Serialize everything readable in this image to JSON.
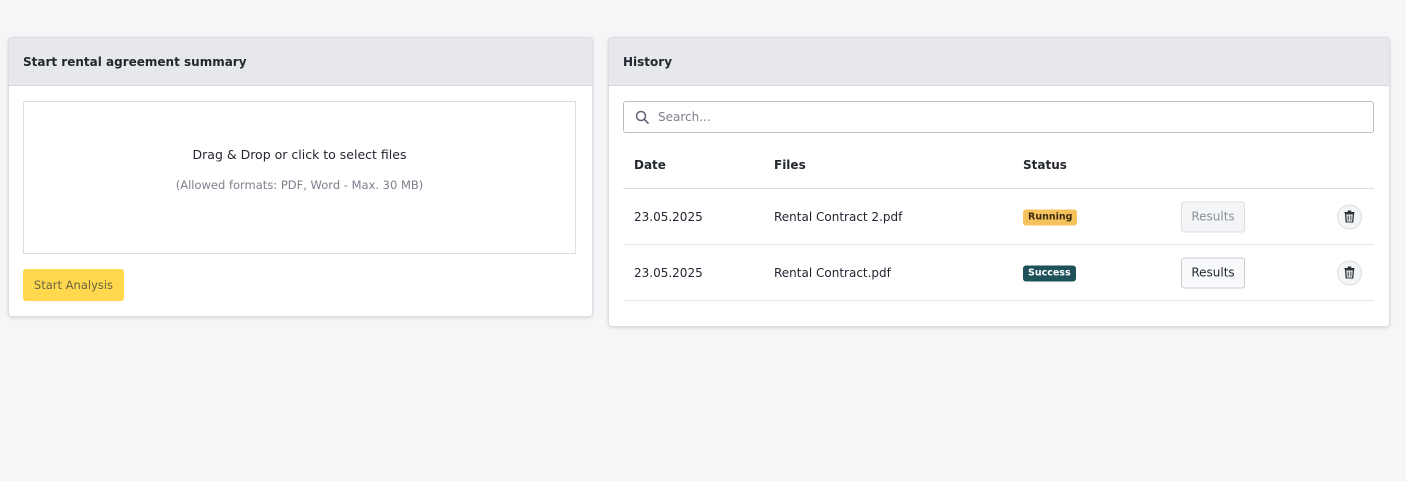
{
  "upload": {
    "title": "Start rental agreement summary",
    "dropzone_title": "Drag & Drop or click to select files",
    "dropzone_hint": "(Allowed formats: PDF, Word - Max. 30 MB)",
    "start_button": "Start Analysis"
  },
  "history": {
    "title": "History",
    "search_placeholder": "Search...",
    "columns": {
      "date": "Date",
      "files": "Files",
      "status": "Status"
    },
    "rows": [
      {
        "date": "23.05.2025",
        "file": "Rental Contract 2.pdf",
        "status": "Running",
        "results_label": "Results",
        "results_enabled": false
      },
      {
        "date": "23.05.2025",
        "file": "Rental Contract.pdf",
        "status": "Success",
        "results_label": "Results",
        "results_enabled": true
      }
    ]
  },
  "colors": {
    "accent": "#ffd84d",
    "running": "#f6c25c",
    "success": "#1e5159"
  },
  "icons": {
    "search": "search-icon",
    "delete": "trash-icon"
  }
}
